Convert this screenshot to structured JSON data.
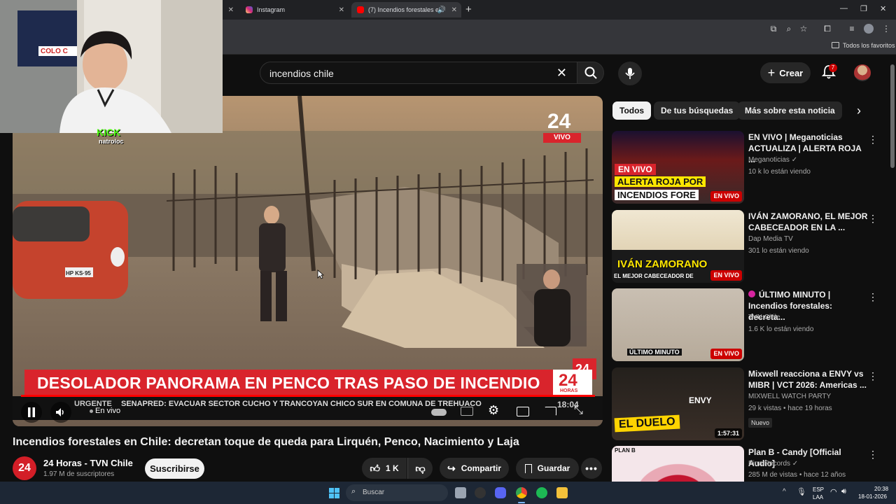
{
  "browser": {
    "tabs": [
      {
        "label": "",
        "favicon_color": "#2e7d32"
      },
      {
        "label": "",
        "favicon_color": "#d6249f"
      },
      {
        "label": "Instagram",
        "favicon_color": "#d6249f"
      },
      {
        "label": "(7) Incendios forestales en C",
        "favicon_color": "#ff0000"
      }
    ],
    "favorites_label": "Todos los favoritos"
  },
  "webcam": {
    "sign_text": "COLO C",
    "kick_label": "KICK",
    "kick_user": "natroloc"
  },
  "youtube": {
    "search": {
      "value": "incendios chile"
    },
    "create_label": "Crear",
    "notifications_count": "7"
  },
  "player": {
    "channel_bug": "24",
    "live_bug": "VIVO",
    "headline": "DESOLADOR PANORAMA EN PENCO TRAS PASO DE INCENDIO",
    "headline_logo": "24",
    "headline_logo_sub": "HORAS",
    "corner_logo": "24",
    "urgent_label": "URGENTE",
    "ticker": "SENAPRED: EVACUAR SECTOR CUCHO Y TRANCOYAN CHICO SUR EN COMUNA DE TREHUACO",
    "clock": "18:04",
    "live_status": "En vivo",
    "plate": "HP KS·95"
  },
  "video": {
    "title": "Incendios forestales en Chile: decretan toque de queda para Lirquén, Penco, Nacimiento y Laja",
    "channel_logo": "24",
    "channel_name": "24 Horas - TVN Chile",
    "subscribers": "1.97 M de suscriptores",
    "subscribe_label": "Suscribirse",
    "likes": "1 K",
    "share_label": "Compartir",
    "save_label": "Guardar"
  },
  "chips": [
    "Todos",
    "De tus búsquedas",
    "Más sobre esta noticia"
  ],
  "recommendations": [
    {
      "title": "EN VIVO | Meganoticias ACTUALIZA | ALERTA ROJA ...",
      "channel": "Meganoticias ✓",
      "meta": "10 k lo están viendo",
      "badge": "EN VIVO",
      "thumb_text_1": "EN VIVO",
      "thumb_text_2": "ALERTA ROJA POR",
      "thumb_text_3": "INCENDIOS FORE"
    },
    {
      "title": "IVÁN ZAMORANO, EL MEJOR CABECEADOR EN LA ...",
      "channel": "Dap Media TV",
      "meta": "301 lo están viendo",
      "badge": "EN VIVO",
      "thumb_text_1": "IVÁN ZAMORANO",
      "thumb_text_2": "EL MEJOR CABECEADOR DE"
    },
    {
      "title": "ÚLTIMO MINUTO | Incendios forestales: decreta...",
      "channel": "TVN Chile",
      "meta": "1.6 K lo están viendo",
      "badge": "EN VIVO",
      "thumb_text_1": "ÚLTIMO MINUTO"
    },
    {
      "title": "Mixwell reacciona a ENVY vs MIBR | VCT 2026: Americas ...",
      "channel": "MIXWELL WATCH PARTY",
      "meta": "29 k vistas • hace 19 horas",
      "new_badge": "Nuevo",
      "duration": "1:57:31",
      "thumb_text_1": "EL DUELO",
      "thumb_text_2": "ENVY"
    },
    {
      "title": "Plan B - Candy [Official Audio]",
      "channel": "Pina Records ✓",
      "meta": "285 M de vistas • hace 12 años",
      "thumb_text_1": "PLAN B"
    }
  ],
  "taskbar": {
    "search_placeholder": "Buscar",
    "lang_1": "ESP",
    "lang_2": "LAA",
    "time": "20:38",
    "date": "18-01-2026"
  }
}
